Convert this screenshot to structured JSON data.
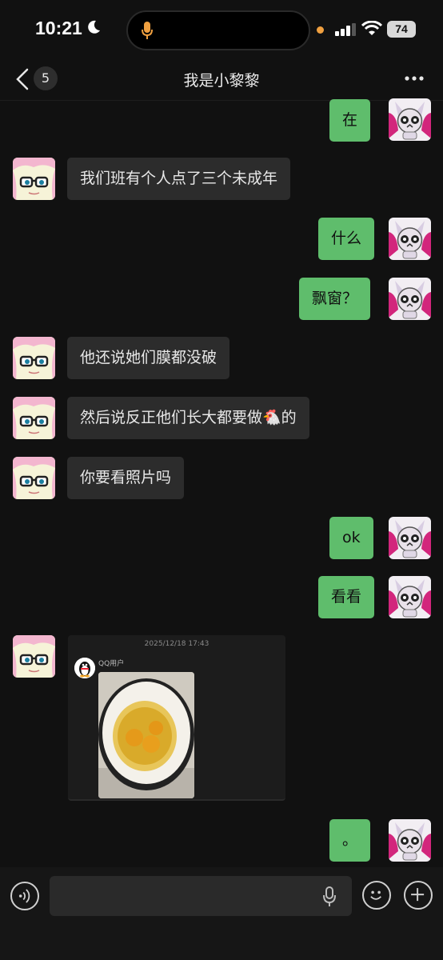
{
  "status_bar": {
    "time": "10:21",
    "battery": "74"
  },
  "nav": {
    "badge": "5",
    "title": "我是小黎黎"
  },
  "messages": [
    {
      "side": "right",
      "text": "在"
    },
    {
      "side": "left",
      "text": "我们班有个人点了三个未成年"
    },
    {
      "side": "right",
      "text": "什么"
    },
    {
      "side": "right",
      "text": "飘窗？"
    },
    {
      "side": "left",
      "text": "他还说她们膜都没破"
    },
    {
      "side": "left",
      "text": "然后说反正他们长大都要做🐔的"
    },
    {
      "side": "left",
      "text": "你要看照片吗"
    },
    {
      "side": "right",
      "text": "ok"
    },
    {
      "side": "right",
      "text": "看看"
    },
    {
      "side": "left",
      "type": "card",
      "date": "2025/12/18 17:43",
      "user": "QQ用户"
    },
    {
      "side": "right",
      "text": "。"
    }
  ],
  "icons": {
    "back": "chevron-left-icon",
    "more": "more-dots-icon",
    "voice": "voice-icon",
    "mic": "microphone-icon",
    "emoji": "emoji-icon",
    "plus": "plus-icon"
  },
  "colors": {
    "background": "#111111",
    "bubble_left": "#2c2c2c",
    "bubble_right": "#5fbd6c"
  }
}
